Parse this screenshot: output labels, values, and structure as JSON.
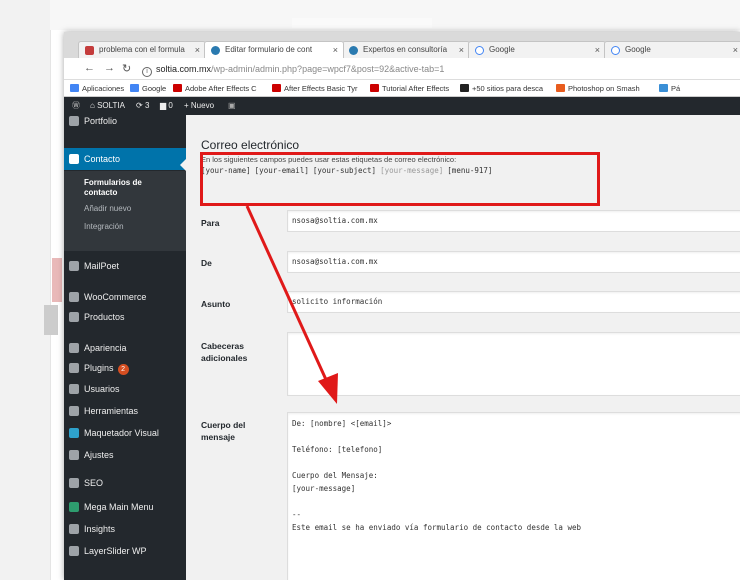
{
  "browser": {
    "tabs": [
      {
        "label": "problema con el formula",
        "favicon": "wordpress-icon",
        "color": "#c43c3c"
      },
      {
        "label": "Editar formulario de cont",
        "favicon": "wordpress-icon",
        "color": "#2a7ab0"
      },
      {
        "label": "Expertos en consultoría",
        "favicon": "wordpress-icon",
        "color": "#2a7ab0"
      },
      {
        "label": "Google",
        "favicon": "google-icon",
        "color": "#4285f4"
      },
      {
        "label": "Google",
        "favicon": "google-icon",
        "color": "#4285f4"
      }
    ],
    "url_domain": "soltia.com.mx",
    "url_path": "/wp-admin/admin.php?page=wpcf7&post=92&active-tab=1",
    "bookmarks": [
      {
        "label": "Aplicaciones",
        "color": "#4285f4"
      },
      {
        "label": "Google",
        "color": "#4285f4"
      },
      {
        "label": "Adobe After Effects C",
        "color": "#cc0000"
      },
      {
        "label": "After Effects Basic Tyr",
        "color": "#cc0000"
      },
      {
        "label": "Tutorial After Effects",
        "color": "#cc0000"
      },
      {
        "label": "+50 sitios para desca",
        "color": "#222222"
      },
      {
        "label": "Photoshop on Smash",
        "color": "#e85c1e"
      },
      {
        "label": "Pá",
        "color": "#3a8fd6"
      }
    ]
  },
  "adminbar": {
    "site": "SOLTIA",
    "updates": "3",
    "comments": "0",
    "new": "Nuevo"
  },
  "sidebar": {
    "items": [
      {
        "label": "Portfolio"
      },
      {
        "label": "Contacto"
      },
      {
        "label": "MailPoet"
      },
      {
        "label": "WooCommerce"
      },
      {
        "label": "Productos"
      },
      {
        "label": "Apariencia"
      },
      {
        "label": "Plugins",
        "badge": "2"
      },
      {
        "label": "Usuarios"
      },
      {
        "label": "Herramientas"
      },
      {
        "label": "Maquetador Visual"
      },
      {
        "label": "Ajustes"
      },
      {
        "label": "SEO"
      },
      {
        "label": "Mega Main Menu"
      },
      {
        "label": "Insights"
      },
      {
        "label": "LayerSlider WP"
      }
    ],
    "submenu": [
      "Formularios de contacto",
      "Añadir nuevo",
      "Integración"
    ]
  },
  "mail": {
    "section_title": "Correo electrónico",
    "hint": "En los siguientes campos puedes usar estas etiquetas de correo electrónico:",
    "tags": [
      "[your-name]",
      "[your-email]",
      "[your-subject]",
      "[your-message]",
      "[menu-917]"
    ],
    "to_label": "Para",
    "to_value": "nsosa@soltia.com.mx",
    "from_label": "De",
    "from_value": "nsosa@soltia.com.mx",
    "subject_label": "Asunto",
    "subject_value": "solicito información",
    "headers_label": "Cabeceras adicionales",
    "headers_value": "",
    "body_label": "Cuerpo del mensaje",
    "body_lines": [
      "De: [nombre] <[email]>",
      "",
      "Teléfono: [telefono]",
      "",
      "Cuerpo del Mensaje:",
      "[your-message]",
      "",
      "--",
      "Este email se ha enviado vía formulario de contacto desde la web"
    ]
  },
  "annotation_color": "#e01919"
}
